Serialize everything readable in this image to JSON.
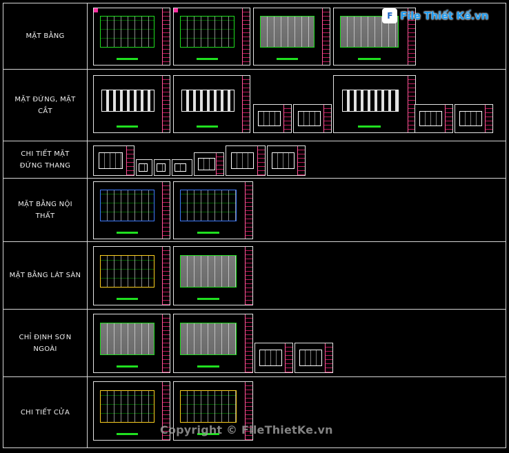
{
  "rows": [
    {
      "label": "MẶT BẰNG"
    },
    {
      "label": "MẶT ĐỨNG, MẶT CẮT"
    },
    {
      "label": "CHI TIẾT MẶT ĐỨNG THANG"
    },
    {
      "label": "MẶT BẰNG NỘI THẤT"
    },
    {
      "label": "MẶT BẰNG LÁT SÀN"
    },
    {
      "label": "CHỈ ĐỊNH SƠN NGOÀI"
    },
    {
      "label": "CHI TIẾT CỬA"
    }
  ],
  "logo": {
    "icon_letter": "F",
    "text": "File Thiết Kế.vn"
  },
  "watermark": "Copyright © FileThietKe.vn",
  "colors": {
    "background": "#000000",
    "grid_line": "#d8d8d8",
    "cad_green": "#20e020",
    "cad_pink": "#ff2fa0",
    "brand_blue": "#1f9cf0"
  }
}
